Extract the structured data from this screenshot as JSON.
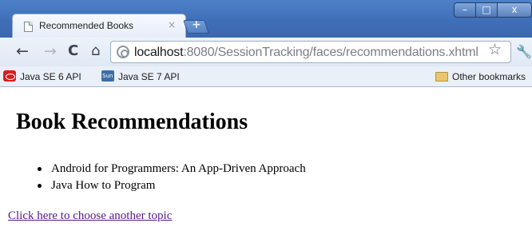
{
  "window": {
    "tab_title": "Recommended Books",
    "tab_close_glyph": "×",
    "new_tab_glyph": "+",
    "controls": {
      "minimize": "–",
      "maximize": "□",
      "close": "x"
    }
  },
  "toolbar": {
    "back_glyph": "←",
    "forward_glyph": "→",
    "reload_glyph": "C",
    "home_glyph": "⌂",
    "url_host": "localhost",
    "url_path": ":8080/SessionTracking/faces/recommendations.xhtml",
    "star_glyph": "☆",
    "wrench_glyph": "🔧",
    "icons": [
      "back-icon",
      "forward-icon",
      "reload-icon",
      "home-icon",
      "page-icon",
      "star-icon",
      "wrench-icon"
    ]
  },
  "bookmarks": {
    "items": [
      {
        "label": "Java SE 6 API",
        "icon": "oracle-icon"
      },
      {
        "label": "Java SE 7 API",
        "icon": "sun-icon"
      }
    ],
    "other_label": "Other bookmarks"
  },
  "page": {
    "title": "Book Recommendations",
    "books": [
      "Android for Programmers: An App-Driven Approach",
      "Java How to Program"
    ],
    "link_label": "Click here to choose another topic"
  },
  "colors": {
    "titlebar": "#4a7bc4",
    "link_visited": "#551a8b",
    "toolbar": "#e6edf7"
  }
}
